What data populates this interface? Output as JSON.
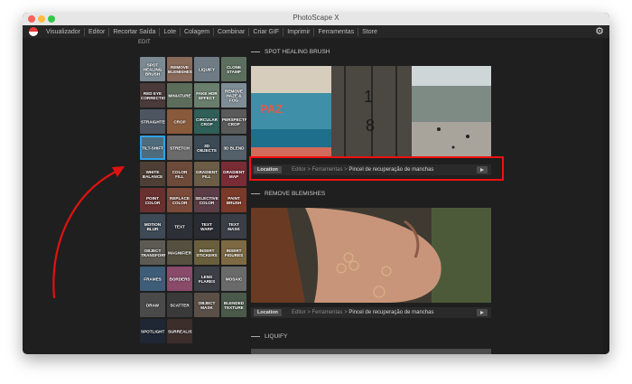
{
  "window": {
    "title": "PhotoScape X"
  },
  "menu": [
    "Visualizador",
    "Editor",
    "Recortar Saída",
    "Lote",
    "Colagem",
    "Combinar",
    "Criar GIF",
    "Imprimir",
    "Ferramentas",
    "Store"
  ],
  "panel_label": "EDIT",
  "tiles": [
    {
      "label": "SPOT HEALING BRUSH",
      "color": "#7b8a93"
    },
    {
      "label": "REMOVE BLEMISHES",
      "color": "#8a6a5a"
    },
    {
      "label": "LIQUIFY",
      "color": "#6f7c86"
    },
    {
      "label": "CLONE STAMP",
      "color": "#5c6f5e"
    },
    {
      "label": "RED EYE CORRECTION",
      "color": "#4a3a3a"
    },
    {
      "label": "MINIATURE",
      "color": "#5d6d5c"
    },
    {
      "label": "FAKE HDR EFFECT",
      "color": "#6a7e6d"
    },
    {
      "label": "REMOVE HAZE & FOG",
      "color": "#7f8d96"
    },
    {
      "label": "STRAIGHTEN",
      "color": "#4c5560"
    },
    {
      "label": "CROP",
      "color": "#8a5a3c"
    },
    {
      "label": "CIRCULAR CROP",
      "color": "#2f5f58"
    },
    {
      "label": "PERSPECTIVE CROP",
      "color": "#5a5a5a"
    },
    {
      "label": "TILT-SHIFT",
      "color": "#4f6c7c",
      "selected": true
    },
    {
      "label": "STRETCH",
      "color": "#6b6b6b"
    },
    {
      "label": "3D OBJECTS",
      "color": "#3b4a55"
    },
    {
      "label": "3D BLEND",
      "color": "#54606a"
    },
    {
      "label": "WHITE BALANCE",
      "color": "#4d3f36"
    },
    {
      "label": "COLOR FILL",
      "color": "#6d4a3a"
    },
    {
      "label": "GRADIENT FILL",
      "color": "#6b5d46"
    },
    {
      "label": "GRADIENT MAP",
      "color": "#7a2c36"
    },
    {
      "label": "POINT COLOR",
      "color": "#6a3030"
    },
    {
      "label": "REPLACE COLOR",
      "color": "#7a4a3a"
    },
    {
      "label": "SELECTIVE COLOR",
      "color": "#5a3d46"
    },
    {
      "label": "PAINT BRUSH",
      "color": "#7a3a2a"
    },
    {
      "label": "MOTION BLUR",
      "color": "#3e4a56"
    },
    {
      "label": "TEXT",
      "color": "#2d3036"
    },
    {
      "label": "TEXT WARP",
      "color": "#2a2c33"
    },
    {
      "label": "TEXT MASK",
      "color": "#3a3e46"
    },
    {
      "label": "OBJECT TRANSFORM",
      "color": "#5c5a52"
    },
    {
      "label": "MAGNIFIER",
      "color": "#55503f"
    },
    {
      "label": "INSERT STICKERS",
      "color": "#6a5f3c"
    },
    {
      "label": "INSERT FIGURES",
      "color": "#7d6a44"
    },
    {
      "label": "FRAMES",
      "color": "#3e5d78"
    },
    {
      "label": "BORDERS",
      "color": "#8a4a6a"
    },
    {
      "label": "LENS FLARES",
      "color": "#3c3f46"
    },
    {
      "label": "MOSAIC",
      "color": "#6a6a6a"
    },
    {
      "label": "DRAW",
      "color": "#4a4a4a"
    },
    {
      "label": "SCATTER",
      "color": "#3a3a3a"
    },
    {
      "label": "OBJECT MASK",
      "color": "#5a5048"
    },
    {
      "label": "BLENDED TEXTURE",
      "color": "#4a5a4a"
    },
    {
      "label": "SPOTLIGHT",
      "color": "#1e2733"
    },
    {
      "label": "SURREALISTIC",
      "color": "#3b2e2b"
    }
  ],
  "sections": [
    {
      "title": "SPOT HEALING BRUSH"
    },
    {
      "title": "REMOVE BLEMISHES"
    },
    {
      "title": "LIQUIFY"
    }
  ],
  "location": {
    "button": "Location",
    "path": "Editor > Ferramentas > ",
    "tool": "Pincel de recuperação de manchas"
  },
  "colors": {
    "highlight": "#e11111",
    "arrow": "#e11111",
    "selection": "#2fa4e7"
  }
}
